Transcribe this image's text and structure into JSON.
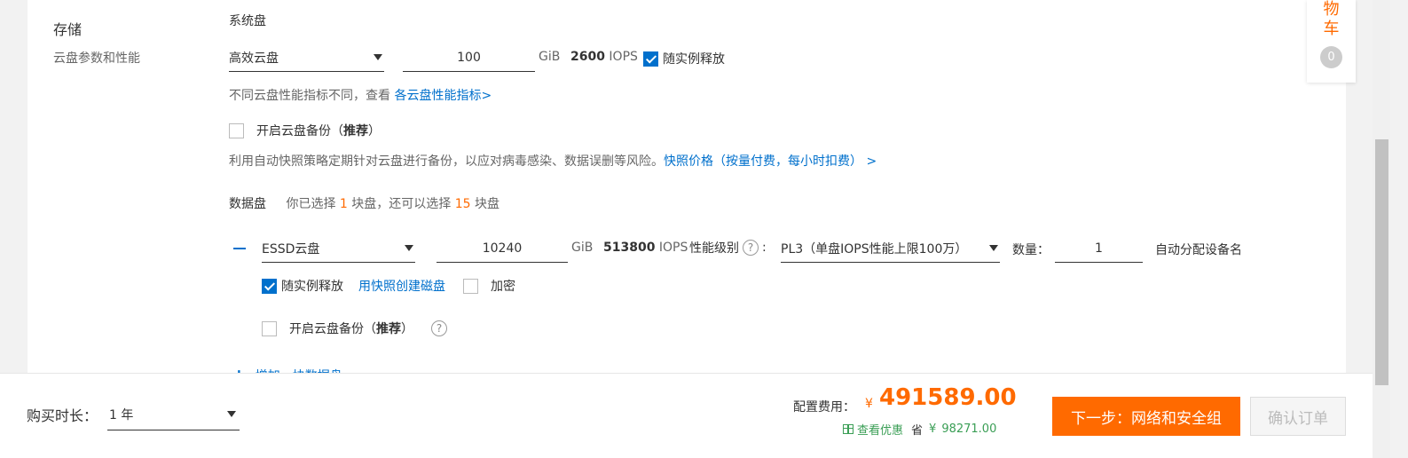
{
  "storage": {
    "title": "存储",
    "subtitle": "云盘参数和性能"
  },
  "system_disk": {
    "label": "系统盘",
    "type": "高效云盘",
    "size": "100",
    "unit": "GiB",
    "iops_value": "2600",
    "iops_unit": "IOPS",
    "release_label": "随实例释放",
    "release_checked": true,
    "perf_note": "不同云盘性能指标不同，查看",
    "perf_link": "各云盘性能指标>",
    "backup_label": "开启云盘备份（",
    "backup_recommend": "推荐",
    "backup_close": "）",
    "backup_desc": "利用自动快照策略定期针对云盘进行备份，以应对病毒感染、数据误删等风险。",
    "backup_price_link": "快照价格（按量付费，每小时扣费） >"
  },
  "data_disk": {
    "label": "数据盘",
    "select_pre": "你已选择",
    "selected_count": "1",
    "select_mid": "块盘，还可以选择",
    "remaining_count": "15",
    "select_post": "块盘",
    "type": "ESSD云盘",
    "size": "10240",
    "unit": "GiB",
    "iops_value": "513800",
    "iops_unit": "IOPS",
    "perf_level_label": "性能级别",
    "perf_level_value": "PL3（单盘IOPS性能上限100万）",
    "quantity_label": "数量：",
    "quantity": "1",
    "auto_assign": "自动分配设备名",
    "release_label": "随实例释放",
    "snapshot_link": "用快照创建磁盘",
    "encrypt_label": "加密",
    "backup_label": "开启云盘备份（",
    "backup_recommend": "推荐",
    "backup_close": "）",
    "add_link": "增加一块数据盘"
  },
  "cart": {
    "line1": "物",
    "line2": "车",
    "count": "0"
  },
  "footer": {
    "duration_label": "购买时长：",
    "duration_value": "1 年",
    "fee_label": "配置费用：",
    "currency": "¥",
    "price": "491589.00",
    "discount_link": "查看优惠",
    "save_label": "省",
    "save_currency": "¥",
    "save_amount": "98271.00",
    "next_button": "下一步：网络和安全组",
    "confirm_button": "确认订单"
  },
  "colors": {
    "accent": "#ff6a00",
    "link": "#0070cc",
    "discount": "#3a9e55"
  }
}
